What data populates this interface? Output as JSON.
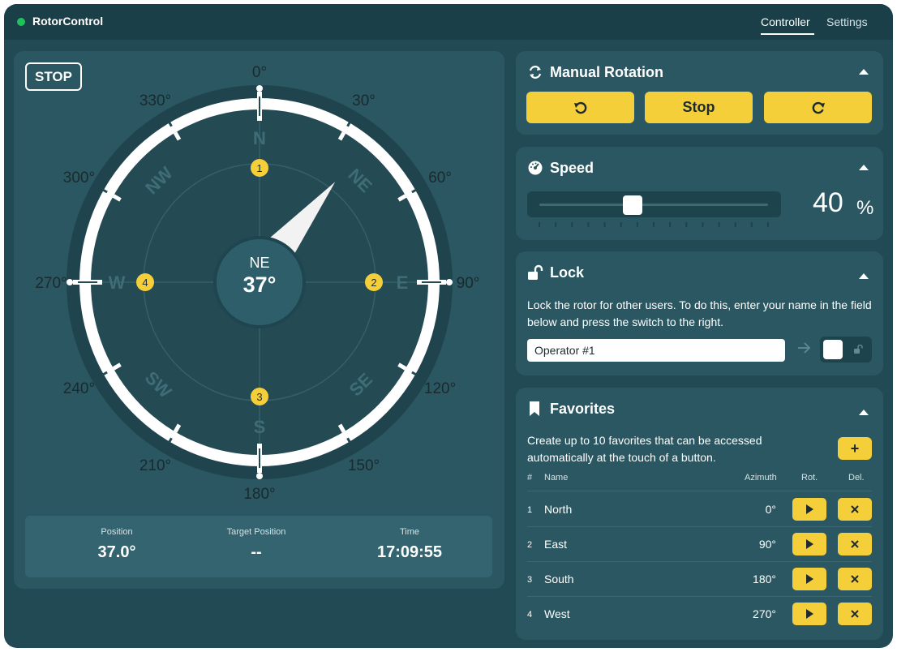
{
  "app": {
    "title": "RotorControl",
    "status_color": "#1ec15a"
  },
  "nav": {
    "tabs": [
      {
        "label": "Controller",
        "active": true
      },
      {
        "label": "Settings",
        "active": false
      }
    ]
  },
  "dial": {
    "state_badge": "STOP",
    "degree_labels": [
      "0°",
      "30°",
      "60°",
      "90°",
      "120°",
      "150°",
      "180°",
      "210°",
      "240°",
      "270°",
      "300°",
      "330°"
    ],
    "cardinals": [
      "N",
      "NE",
      "E",
      "SE",
      "S",
      "SW",
      "W",
      "NW"
    ],
    "favorite_markers": [
      {
        "number": "1",
        "azimuth": 0
      },
      {
        "number": "2",
        "azimuth": 90
      },
      {
        "number": "3",
        "azimuth": 180
      },
      {
        "number": "4",
        "azimuth": 270
      }
    ],
    "pointer_azimuth": 37,
    "center_direction": "NE",
    "center_value": "37°"
  },
  "readout": [
    {
      "label": "Position",
      "value": "37.0°"
    },
    {
      "label": "Target Position",
      "value": "--"
    },
    {
      "label": "Time",
      "value": "17:09:55"
    }
  ],
  "manual": {
    "title": "Manual Rotation",
    "icon": "rotate-arrows-icon",
    "buttons": {
      "ccw_icon": "rotate-ccw-icon",
      "stop_label": "Stop",
      "cw_icon": "rotate-cw-icon"
    }
  },
  "speed": {
    "title": "Speed",
    "icon": "speedometer-icon",
    "level_percent": 40,
    "value": "40",
    "unit": "%"
  },
  "lock": {
    "title": "Lock",
    "icon": "unlocked-padlock-icon",
    "description": "Lock the rotor for other users. To do this, enter your name in the field below and press the switch to the right.",
    "input_value": "Operator #1",
    "locked": false
  },
  "favorites": {
    "title": "Favorites",
    "icon": "bookmark-icon",
    "description": "Create up to 10 favorites that can be accessed automatically at the touch of a button.",
    "add_label": "+",
    "columns": {
      "num": "#",
      "name": "Name",
      "azimuth": "Azimuth",
      "rotate": "Rot.",
      "delete": "Del."
    },
    "rows": [
      {
        "num": "1",
        "name": "North",
        "azimuth": "0°"
      },
      {
        "num": "2",
        "name": "East",
        "azimuth": "90°"
      },
      {
        "num": "3",
        "name": "South",
        "azimuth": "180°"
      },
      {
        "num": "4",
        "name": "West",
        "azimuth": "270°"
      }
    ]
  },
  "colors": {
    "background": "#224a54",
    "panel": "#2a5761",
    "accent_yellow": "#f5cf3a",
    "dial_inner": "#244a54",
    "ring": "#ffffff"
  }
}
